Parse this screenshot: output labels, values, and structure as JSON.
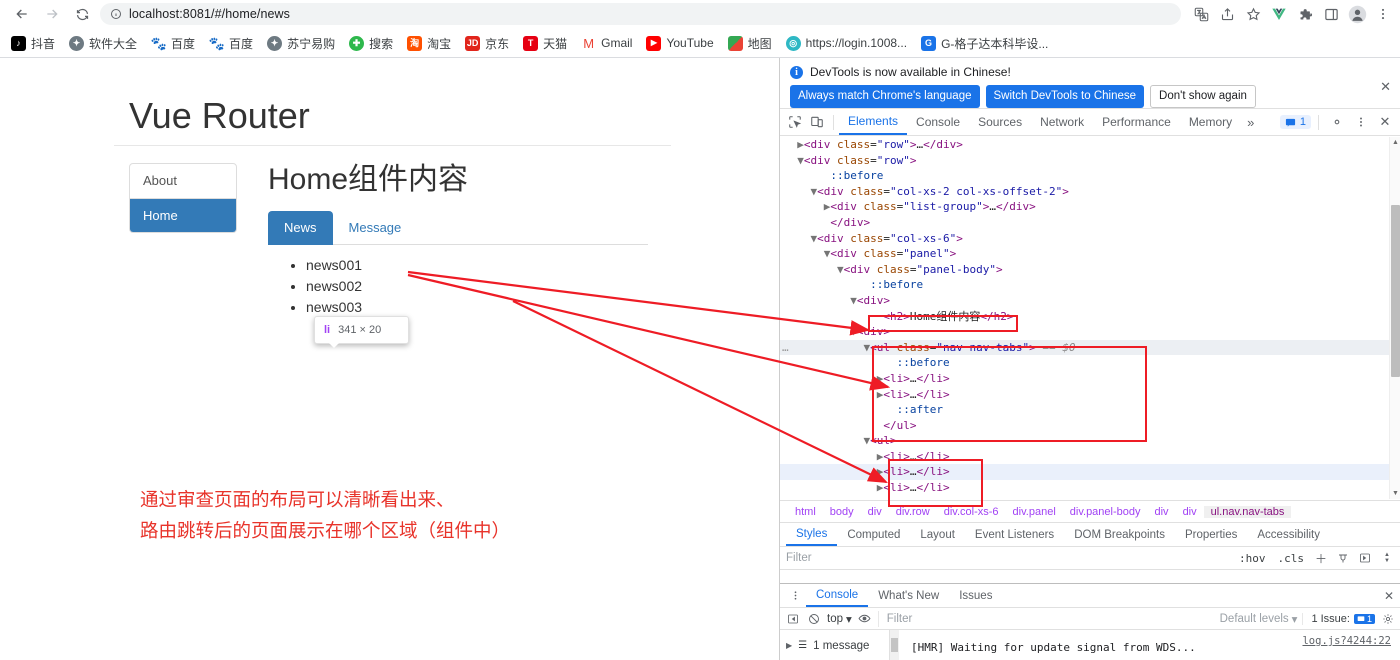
{
  "browser": {
    "back_icon": "back-arrow-icon",
    "forward_icon": "forward-arrow-icon",
    "reload_icon": "reload-icon",
    "site_info_icon": "info-circle-icon",
    "url_host": "localhost:8081",
    "url_path": "/#/home/news",
    "url_full": "localhost:8081/#/home/news",
    "toolbar_icons": [
      "translate-icon",
      "share-icon",
      "bookmark-star-icon",
      "vue-devtools-icon",
      "extensions-puzzle-icon",
      "side-panel-icon",
      "profile-avatar-icon",
      "chrome-menu-icon"
    ]
  },
  "bookmarks": [
    {
      "label": "抖音",
      "icon": "douyin-icon",
      "cls": "douyin",
      "glyph": "♪"
    },
    {
      "label": "软件大全",
      "icon": "globe-icon",
      "cls": "soft",
      "glyph": "✦"
    },
    {
      "label": "百度",
      "icon": "baidu-icon",
      "cls": "baidu",
      "glyph": "熊"
    },
    {
      "label": "百度",
      "icon": "baidu-icon",
      "cls": "baidu",
      "glyph": "熊"
    },
    {
      "label": "苏宁易购",
      "icon": "globe-icon",
      "cls": "suning",
      "glyph": "✦"
    },
    {
      "label": "搜索",
      "icon": "search-plus-icon",
      "cls": "sousuo",
      "glyph": "✚"
    },
    {
      "label": "淘宝",
      "icon": "taobao-icon",
      "cls": "taobao",
      "glyph": "淘"
    },
    {
      "label": "京东",
      "icon": "jd-icon",
      "cls": "jd",
      "glyph": "JD"
    },
    {
      "label": "天猫",
      "icon": "tmall-icon",
      "cls": "tmall",
      "glyph": "T"
    },
    {
      "label": "Gmail",
      "icon": "gmail-icon",
      "cls": "gmail",
      "glyph": "M"
    },
    {
      "label": "YouTube",
      "icon": "youtube-icon",
      "cls": "youtube",
      "glyph": "▶"
    },
    {
      "label": "地图",
      "icon": "maps-icon",
      "cls": "ditu",
      "glyph": ""
    },
    {
      "label": "https://login.1008...",
      "icon": "globe-icon",
      "cls": "login",
      "glyph": "◎"
    },
    {
      "label": "G-格子达本科毕设...",
      "icon": "doc-icon",
      "cls": "gezi",
      "glyph": "G"
    }
  ],
  "page": {
    "title": "Vue Router",
    "list_group": [
      {
        "label": "About",
        "active": false
      },
      {
        "label": "Home",
        "active": true
      }
    ],
    "panel_heading": "Home组件内容",
    "tabs": [
      {
        "label": "News",
        "active": true
      },
      {
        "label": "Message",
        "active": false
      }
    ],
    "news_items": [
      {
        "label": "news001",
        "highlighted": false
      },
      {
        "label": "news002",
        "highlighted": true
      },
      {
        "label": "news003",
        "highlighted": false
      }
    ],
    "inspector_tooltip": {
      "tag": "li",
      "dimensions": "341 × 20"
    },
    "annotation_lines": [
      "通过审查页面的布局可以清晰看出来、",
      "路由跳转后的页面展示在哪个区域（组件中）"
    ],
    "annotation_color": "#e8332a"
  },
  "devtools": {
    "banner": {
      "message": "DevTools is now available in Chinese!",
      "buttons": [
        {
          "label": "Always match Chrome's language",
          "style": "primary"
        },
        {
          "label": "Switch DevTools to Chinese",
          "style": "primary"
        },
        {
          "label": "Don't show again",
          "style": "plain"
        }
      ],
      "close_icon": "close-icon"
    },
    "tabs": [
      {
        "label": "Elements",
        "active": true
      },
      {
        "label": "Console",
        "active": false
      },
      {
        "label": "Sources",
        "active": false
      },
      {
        "label": "Network",
        "active": false
      },
      {
        "label": "Performance",
        "active": false
      },
      {
        "label": "Memory",
        "active": false
      }
    ],
    "more_tabs_icon": "chevron-double-right-icon",
    "messages_count": "1",
    "settings_icon": "gear-icon",
    "kebab_icon": "more-vertical-icon",
    "close_icon": "close-icon",
    "inspect_icon": "inspect-element-icon",
    "device_icon": "device-toolbar-icon",
    "dom_lines": [
      {
        "indent": 1,
        "arrow": "right",
        "html": "<span class=\"tg\">&lt;div</span> <span class=\"at\">class</span>=<span class=\"av\">\"row\"</span><span class=\"tg\">&gt;</span>…<span class=\"tg\">&lt;/div&gt;</span>"
      },
      {
        "indent": 1,
        "arrow": "down",
        "html": "<span class=\"tg\">&lt;div</span> <span class=\"at\">class</span>=<span class=\"av\">\"row\"</span><span class=\"tg\">&gt;</span>"
      },
      {
        "indent": 3,
        "arrow": "",
        "html": "<span class=\"pu\">::before</span>"
      },
      {
        "indent": 2,
        "arrow": "down",
        "html": "<span class=\"tg\">&lt;div</span> <span class=\"at\">class</span>=<span class=\"av\">\"col-xs-2 col-xs-offset-2\"</span><span class=\"tg\">&gt;</span>"
      },
      {
        "indent": 3,
        "arrow": "right",
        "html": "<span class=\"tg\">&lt;div</span> <span class=\"at\">class</span>=<span class=\"av\">\"list-group\"</span><span class=\"tg\">&gt;</span>…<span class=\"tg\">&lt;/div&gt;</span>"
      },
      {
        "indent": 3,
        "arrow": "",
        "html": "<span class=\"tg\">&lt;/div&gt;</span>"
      },
      {
        "indent": 2,
        "arrow": "down",
        "html": "<span class=\"tg\">&lt;div</span> <span class=\"at\">class</span>=<span class=\"av\">\"col-xs-6\"</span><span class=\"tg\">&gt;</span>"
      },
      {
        "indent": 3,
        "arrow": "down",
        "html": "<span class=\"tg\">&lt;div</span> <span class=\"at\">class</span>=<span class=\"av\">\"panel\"</span><span class=\"tg\">&gt;</span>"
      },
      {
        "indent": 4,
        "arrow": "down",
        "html": "<span class=\"tg\">&lt;div</span> <span class=\"at\">class</span>=<span class=\"av\">\"panel-body\"</span><span class=\"tg\">&gt;</span>"
      },
      {
        "indent": 6,
        "arrow": "",
        "html": "<span class=\"pu\">::before</span>"
      },
      {
        "indent": 5,
        "arrow": "down",
        "html": "<span class=\"tg\">&lt;div&gt;</span>"
      },
      {
        "indent": 7,
        "arrow": "",
        "html": "<span class=\"tg\">&lt;h2&gt;</span><span class=\"pk\">Home组件内容</span><span class=\"tg\">&lt;/h2&gt;</span>"
      },
      {
        "indent": 5,
        "arrow": "down",
        "html": "<span class=\"tg\">&lt;div&gt;</span>"
      },
      {
        "indent": 6,
        "arrow": "down",
        "sel": true,
        "ellipsis": true,
        "html": "<span class=\"tg\">&lt;ul</span> <span class=\"at\">class</span>=<span class=\"av\">\"nav nav-tabs\"</span><span class=\"tg\">&gt;</span> <span class=\"sel0\">== $0</span>"
      },
      {
        "indent": 8,
        "arrow": "",
        "html": "<span class=\"pu\">::before</span>"
      },
      {
        "indent": 7,
        "arrow": "right",
        "html": "<span class=\"tg\">&lt;li&gt;</span>…<span class=\"tg\">&lt;/li&gt;</span>"
      },
      {
        "indent": 7,
        "arrow": "right",
        "html": "<span class=\"tg\">&lt;li&gt;</span>…<span class=\"tg\">&lt;/li&gt;</span>"
      },
      {
        "indent": 8,
        "arrow": "",
        "html": "<span class=\"pu\">::after</span>"
      },
      {
        "indent": 7,
        "arrow": "",
        "html": "<span class=\"tg\">&lt;/ul&gt;</span>"
      },
      {
        "indent": 6,
        "arrow": "down",
        "html": "<span class=\"tg\">&lt;ul&gt;</span>"
      },
      {
        "indent": 7,
        "arrow": "right",
        "html": "<span class=\"tg\">&lt;li&gt;</span>…<span class=\"tg\">&lt;/li&gt;</span>"
      },
      {
        "indent": 7,
        "arrow": "right",
        "hover": true,
        "html": "<span class=\"tg\">&lt;li&gt;</span>…<span class=\"tg\">&lt;/li&gt;</span>"
      },
      {
        "indent": 7,
        "arrow": "right",
        "html": "<span class=\"tg\">&lt;li&gt;</span>…<span class=\"tg\">&lt;/li&gt;</span>"
      }
    ],
    "breadcrumbs": [
      {
        "label": "html",
        "active": false
      },
      {
        "label": "body",
        "active": false
      },
      {
        "label": "div",
        "active": false
      },
      {
        "label": "div.row",
        "active": false
      },
      {
        "label": "div.col-xs-6",
        "active": false
      },
      {
        "label": "div.panel",
        "active": false
      },
      {
        "label": "div.panel-body",
        "active": false
      },
      {
        "label": "div",
        "active": false
      },
      {
        "label": "div",
        "active": false
      },
      {
        "label": "ul.nav.nav-tabs",
        "active": true
      }
    ],
    "style_tabs": [
      {
        "label": "Styles",
        "active": true
      },
      {
        "label": "Computed",
        "active": false
      },
      {
        "label": "Layout",
        "active": false
      },
      {
        "label": "Event Listeners",
        "active": false
      },
      {
        "label": "DOM Breakpoints",
        "active": false
      },
      {
        "label": "Properties",
        "active": false
      },
      {
        "label": "Accessibility",
        "active": false
      }
    ],
    "styles_filter_placeholder": "Filter",
    "styles_filter_buttons": [
      ":hov",
      ".cls"
    ],
    "styles_filter_icons": [
      "add-style-rule-icon",
      "color-picker-icon",
      "toggle-sidebar-icon",
      "stepper-icon"
    ],
    "drawer": {
      "kebab_icon": "more-vertical-icon",
      "tabs": [
        {
          "label": "Console",
          "active": true
        },
        {
          "label": "What's New",
          "active": false
        },
        {
          "label": "Issues",
          "active": false
        }
      ],
      "close_icon": "close-icon",
      "sidebar_toggle_icon": "console-sidebar-icon",
      "clear_icon": "clear-console-icon",
      "context": "top",
      "eye_icon": "live-expression-icon",
      "filter_placeholder": "Filter",
      "levels_label": "Default levels",
      "issues_label": "1 Issue:",
      "issues_count": "1",
      "settings_icon": "gear-icon",
      "message_count_label": "1 message",
      "log_text": "[HMR] Waiting for update signal from WDS...",
      "log_source": "log.js?4244:22"
    }
  }
}
